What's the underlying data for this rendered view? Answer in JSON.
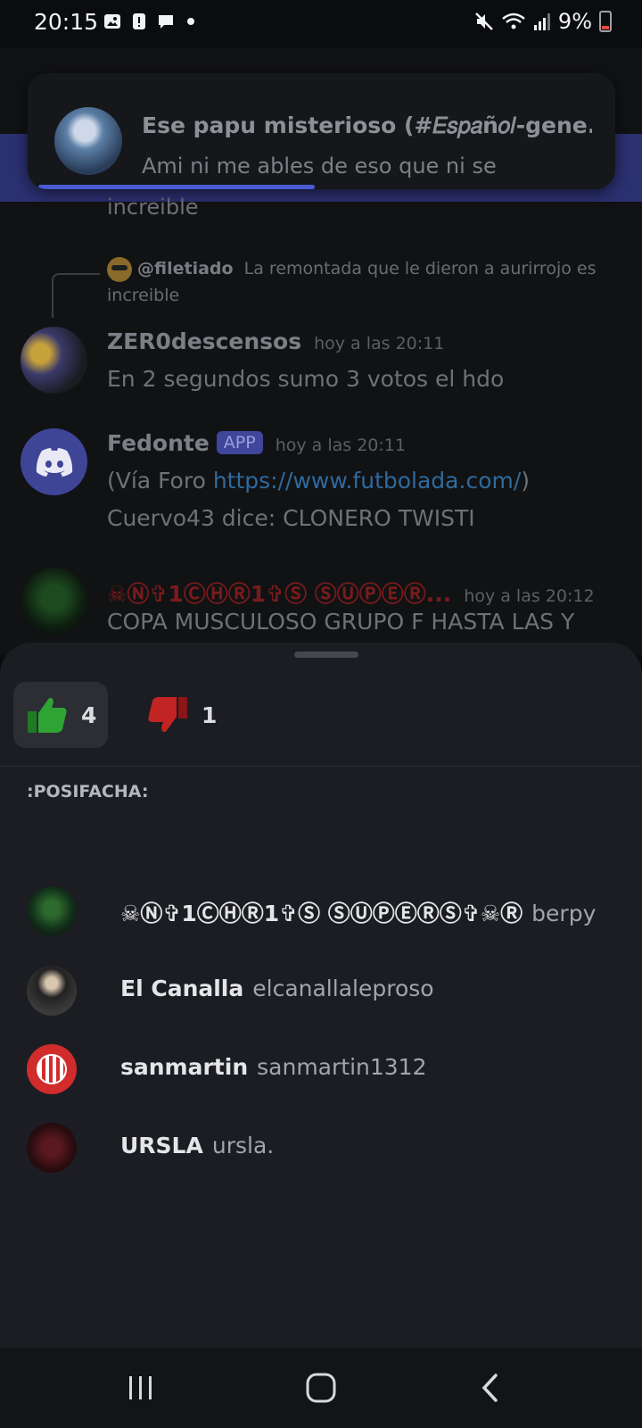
{
  "status_bar": {
    "time": "20:15",
    "battery": "9%",
    "left_icons": [
      "gallery-icon",
      "alert-icon",
      "chat-bubble-icon",
      "dot-icon"
    ],
    "right_icons": [
      "mute-icon",
      "wifi-icon",
      "signal-icon",
      "battery-icon"
    ]
  },
  "notification": {
    "title": "Ese papu misterioso (#𝐸𝑠𝑝𝑎ñ𝑜𝑙-gene...",
    "body": "Ami ni me ables de eso que ni se"
  },
  "chat": {
    "prev_continuation": "increible",
    "reply": {
      "user": "@filetiado",
      "text": "La remontada que le dieron a aurirrojo es increible"
    },
    "messages": [
      {
        "author": "ZER0descensos",
        "time": "hoy a las 20:11",
        "lines": [
          "En 2 segundos sumo 3 votos el hdo"
        ]
      },
      {
        "author": "Fedonte",
        "badge": "APP",
        "time": "hoy a las 20:11",
        "line1_prefix": "(Vía Foro ",
        "line1_link": "https://www.futbolada.com/",
        "line1_suffix": ")",
        "line2": "Cuervo43 dice: CLONERO TWISTI"
      },
      {
        "author": "☠Ⓝ✞1ⒸⒽⓇ1✞Ⓢ ⓈⓊⓅⒺⓇ...",
        "time": "hoy a las 20:12",
        "lines": [
          "COPA MUSCULOSO GRUPO F HASTA LAS Y"
        ]
      }
    ]
  },
  "reactions_sheet": {
    "reactions": [
      {
        "emoji": "thumbs-up-icon",
        "count": "4",
        "selected": true,
        "color": "#2fa334"
      },
      {
        "emoji": "thumbs-down-icon",
        "count": "1",
        "selected": false,
        "color": "#c22323"
      }
    ],
    "section_label": ":POSIFACHA:",
    "users": [
      {
        "display": "☠Ⓝ✞1ⒸⒽⓇ1✞Ⓢ ⓈⓊⓅⒺⓇⓈ✞☠Ⓡ",
        "username": "berpy"
      },
      {
        "display": "El Canalla",
        "username": "elcanallaleproso"
      },
      {
        "display": "sanmartin",
        "username": "sanmartin1312"
      },
      {
        "display": "URSLA",
        "username": "ursla."
      }
    ]
  },
  "nav_bar": {
    "buttons": [
      "recent-apps-icon",
      "home-icon",
      "back-icon"
    ]
  },
  "colors": {
    "background": "#0b0c0e",
    "sheet": "#1c1d22",
    "accent": "#4c5bd4",
    "link": "#2e6a9e"
  }
}
